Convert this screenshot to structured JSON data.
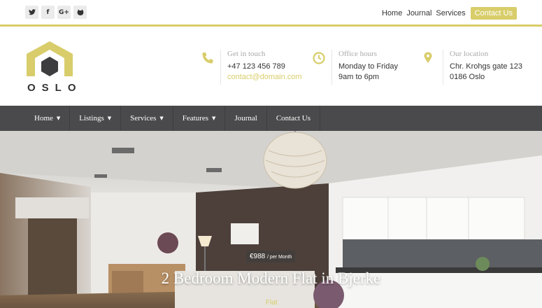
{
  "social": {
    "twitter": "𝕏",
    "facebook": "f",
    "google": "G+",
    "github": "●"
  },
  "top_nav": {
    "links": [
      "Home",
      "Journal",
      "Services"
    ],
    "cta": "Contact Us"
  },
  "logo": {
    "text": "OSLO"
  },
  "info": {
    "contact": {
      "title": "Get in touch",
      "line1": "+47 123 456 789",
      "line2": "contact@domain.com"
    },
    "hours": {
      "title": "Office hours",
      "line1": "Monday to Friday",
      "line2": "9am to 6pm"
    },
    "location": {
      "title": "Our location",
      "line1": "Chr. Krohgs gate 123",
      "line2": "0186 Oslo"
    }
  },
  "main_nav": {
    "items": [
      {
        "label": "Home",
        "dropdown": true
      },
      {
        "label": "Listings",
        "dropdown": true
      },
      {
        "label": "Services",
        "dropdown": true
      },
      {
        "label": "Features",
        "dropdown": true
      },
      {
        "label": "Journal",
        "dropdown": false
      },
      {
        "label": "Contact Us",
        "dropdown": false
      }
    ]
  },
  "hero": {
    "price": "€988",
    "price_period": "/ per Month",
    "title": "2 Bedroom Modern Flat in Bjerke",
    "tag": "Flat"
  },
  "colors": {
    "accent": "#d8cd6a",
    "nav_bg": "#4a4a4c"
  }
}
